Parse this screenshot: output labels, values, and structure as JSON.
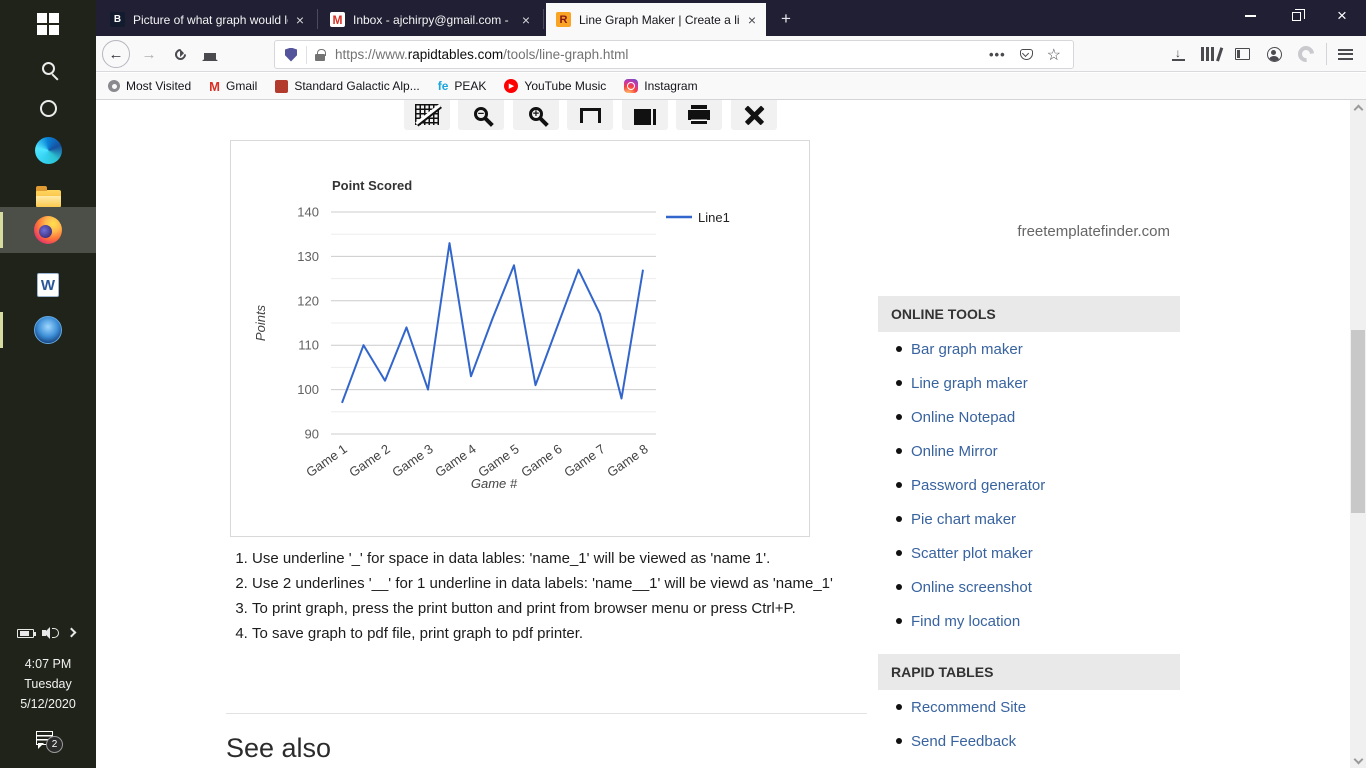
{
  "taskbar": {
    "icons": [
      "start",
      "search",
      "cortana",
      "edge",
      "file-explorer",
      "firefox",
      "word",
      "media-player",
      "battery",
      "speaker",
      "hidden-icons-chevron",
      "action-center"
    ],
    "word_glyph": "W",
    "clock": {
      "time": "4:07 PM",
      "day": "Tuesday",
      "date": "5/12/2020"
    },
    "notification_badge": "2"
  },
  "browser": {
    "tabs": [
      {
        "favicon": "B",
        "title": "Picture of what graph would lo"
      },
      {
        "favicon": "M",
        "title": "Inbox - ajchirpy@gmail.com -"
      },
      {
        "favicon": "R",
        "title": "Line Graph Maker | Create a lin"
      }
    ],
    "new_tab_glyph": "+",
    "window_controls": [
      "minimize",
      "restore",
      "close"
    ],
    "toolbar_icons": [
      "back",
      "forward",
      "reload",
      "home",
      "tracking-shield",
      "lock",
      "page-actions",
      "pocket",
      "bookmark-star",
      "downloads",
      "library",
      "sidebars",
      "account",
      "extension",
      "menu"
    ],
    "url": {
      "prefix": "https://www.",
      "domain": "rapidtables.com",
      "path": "/tools/line-graph.html"
    },
    "download_glyph": "↓",
    "back_glyph": "←",
    "forward_glyph": "→",
    "star_glyph": "☆",
    "dots_glyph": "•••",
    "bookmarks": [
      "Most Visited",
      "Gmail",
      "Standard Galactic Alp...",
      "PEAK",
      "YouTube Music",
      "Instagram"
    ],
    "bookmark_glyphs": {
      "gmail": "M",
      "peak": "fe",
      "play": "▶"
    }
  },
  "page": {
    "toolbar_icons": [
      "edit-graph",
      "zoom-out",
      "zoom-in",
      "save",
      "fullscreen",
      "print",
      "delete"
    ],
    "zoom_out_glyph": "−",
    "zoom_in_glyph": "+",
    "ad_text": "freetemplatefinder.com",
    "instructions": [
      "Use underline '_' for space in data lables: 'name_1' will be viewed as 'name 1'.",
      "Use 2 underlines '__' for 1 underline in data labels: 'name__1' will be viewd as 'name_1'",
      "To print graph, press the print button and print from browser menu or press Ctrl+P.",
      "To save graph to pdf file, print graph to pdf printer."
    ],
    "see_also": "See also",
    "sidebar": {
      "online_tools": {
        "header": "ONLINE TOOLS",
        "links": [
          "Bar graph maker",
          "Line graph maker",
          "Online Notepad",
          "Online Mirror",
          "Password generator",
          "Pie chart maker",
          "Scatter plot maker",
          "Online screenshot",
          "Find my location"
        ]
      },
      "rapid_tables": {
        "header": "RAPID TABLES",
        "links": [
          "Recommend Site",
          "Send Feedback"
        ]
      }
    }
  },
  "chart_data": {
    "type": "line",
    "title": "Point Scored",
    "xlabel": "Game #",
    "ylabel": "Points",
    "categories": [
      "Game 1",
      "Game 2",
      "Game 3",
      "Game 4",
      "Game 5",
      "Game 6",
      "Game 7",
      "Game 8"
    ],
    "label_every_n_points": 2,
    "series": [
      {
        "name": "Line1",
        "values": [
          97,
          110,
          102,
          114,
          100,
          133,
          103,
          116,
          128,
          101,
          114,
          127,
          117,
          98,
          127
        ]
      }
    ],
    "ylim": [
      90,
      140
    ],
    "ytick_step": 10,
    "ytick_minor": 5,
    "grid": true,
    "legend_position": "right",
    "colors": {
      "line": "#3366cc",
      "major_grid": "#cccccc",
      "minor_grid": "#ededed",
      "tick_text": "#616161",
      "axis_title": "#444444",
      "title_text": "#333333"
    }
  }
}
